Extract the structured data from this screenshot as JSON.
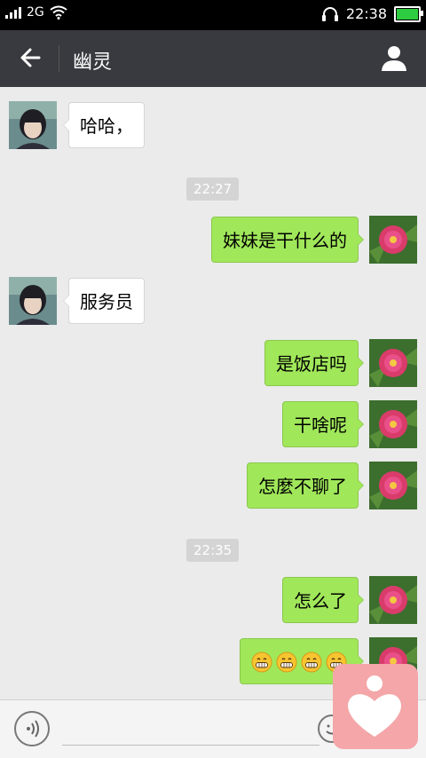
{
  "status_bar": {
    "network": "2G",
    "time": "22:38"
  },
  "header": {
    "title": "幽灵"
  },
  "messages": [
    {
      "text": "哈哈，"
    },
    {
      "timestamp": "22:27"
    },
    {
      "text": "妹妹是干什么的"
    },
    {
      "text": "服务员"
    },
    {
      "text": "是饭店吗"
    },
    {
      "text": "干啥呢"
    },
    {
      "text": "怎麼不聊了"
    },
    {
      "timestamp": "22:35"
    },
    {
      "text": "怎么了"
    },
    {
      "emoji": "grin-emoji",
      "count": 4
    }
  ],
  "colors": {
    "outgoing_bubble": "#a0e75a",
    "incoming_bubble": "#ffffff",
    "header_bg": "#393a3f",
    "floating_widget": "#f4a6a8"
  },
  "icons": [
    "back-arrow-icon",
    "profile-icon",
    "voice-icon",
    "emoji-icon",
    "heart-icon"
  ]
}
